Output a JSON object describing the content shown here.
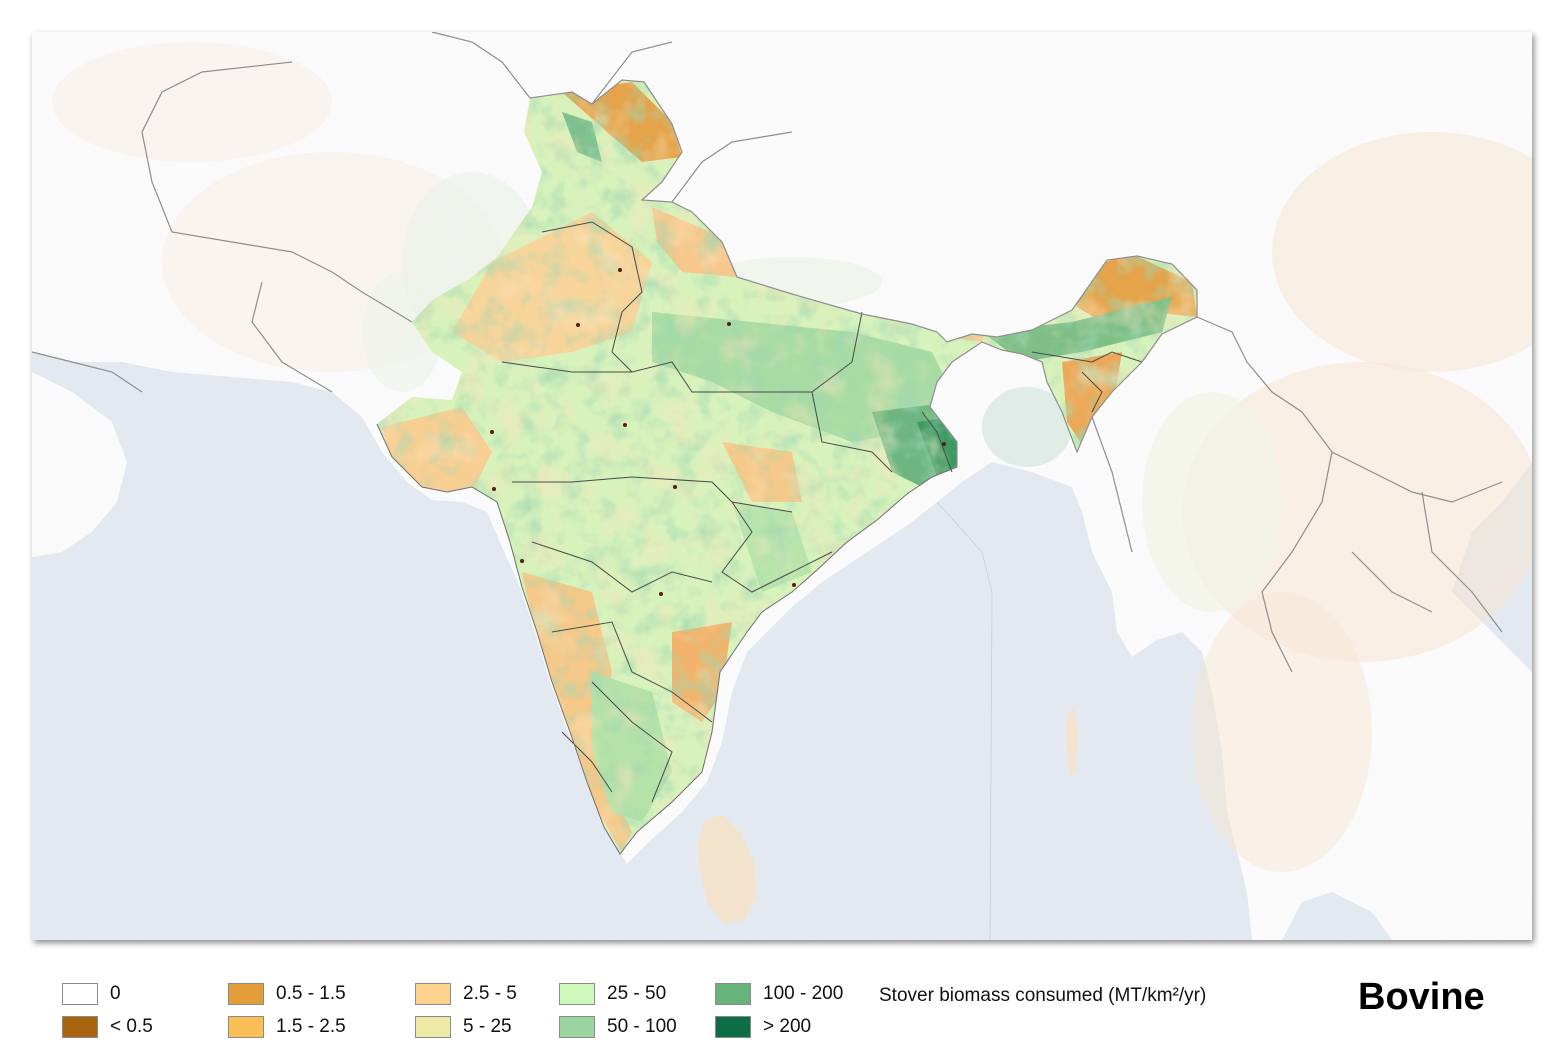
{
  "map": {
    "title": "Bovine",
    "legend_title": "Stover biomass consumed (MT/km²/yr)",
    "colors": {
      "ocean": "#e2e9f2",
      "land_outside": "#fbfbfd",
      "land_outside_tint": "#f6e6d2",
      "border": "#8e8e8e",
      "state_border": "#4a4a4a"
    },
    "legend": [
      {
        "label": "0",
        "color": "#ffffff"
      },
      {
        "label": "< 0.5",
        "color": "#a9640f"
      },
      {
        "label": "0.5 - 1.5",
        "color": "#e39e3a"
      },
      {
        "label": "1.5 - 2.5",
        "color": "#fbbf56"
      },
      {
        "label": "2.5 - 5",
        "color": "#fcd28d"
      },
      {
        "label": "5 - 25",
        "color": "#eee9a6"
      },
      {
        "label": "25 - 50",
        "color": "#cff9bb"
      },
      {
        "label": "50 - 100",
        "color": "#9bd5a0"
      },
      {
        "label": "100 - 200",
        "color": "#66b47c"
      },
      {
        "label": "> 200",
        "color": "#0d6d46"
      }
    ]
  }
}
